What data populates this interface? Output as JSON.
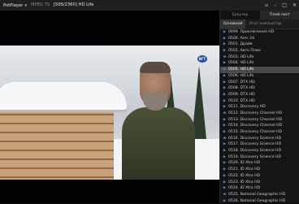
{
  "titlebar": {
    "app_name": "PotPlayer",
    "codec": "MPEG TS",
    "title": "[505/2360] HD Life"
  },
  "video": {
    "channel_logo_text": "ВГТ"
  },
  "panel": {
    "tabs": [
      {
        "label": "Браузер",
        "active": false
      },
      {
        "label": "Плей-лист",
        "active": true
      }
    ],
    "subtabs": [
      {
        "label": "Основной",
        "active": true
      },
      {
        "label": "Этот компьютер",
        "active": false
      }
    ],
    "items": [
      {
        "label": "0499. Приключения HD",
        "icon": "play-icon"
      },
      {
        "label": "0500. Amc 24",
        "icon": "play-icon"
      },
      {
        "label": "0501. Драйв",
        "icon": "play-icon"
      },
      {
        "label": "0502. Авто Плюс",
        "icon": "play-icon"
      },
      {
        "label": "0503. HD Life",
        "icon": "ie-icon"
      },
      {
        "label": "0504. HD Life",
        "icon": "play-icon"
      },
      {
        "label": "0505. HD Life",
        "icon": "play-icon",
        "selected": true
      },
      {
        "label": "0506. HD Life",
        "icon": "play-icon"
      },
      {
        "label": "0507. DTX HD",
        "icon": "play-icon"
      },
      {
        "label": "0508. DTX HD",
        "icon": "play-icon"
      },
      {
        "label": "0509. DTX HD",
        "icon": "play-icon"
      },
      {
        "label": "0510. DTX HD",
        "icon": "play-icon"
      },
      {
        "label": "0511. Discovery HD",
        "icon": "play-icon"
      },
      {
        "label": "0512. Discovery Channel HD",
        "icon": "ie-icon"
      },
      {
        "label": "0513. Discovery Channel HD",
        "icon": "play-icon"
      },
      {
        "label": "0514. Discovery Channel HD",
        "icon": "play-icon"
      },
      {
        "label": "0515. Discovery Channel HD",
        "icon": "play-icon"
      },
      {
        "label": "0516. Discovery Science HD",
        "icon": "ie-icon"
      },
      {
        "label": "0517. Discovery Science HD",
        "icon": "play-icon"
      },
      {
        "label": "0518. Discovery Science HD",
        "icon": "play-icon"
      },
      {
        "label": "0519. Discovery Science HD",
        "icon": "play-icon"
      },
      {
        "label": "0520. ID Xtra HD",
        "icon": "play-icon"
      },
      {
        "label": "0521. ID Xtra HD",
        "icon": "play-icon"
      },
      {
        "label": "0522. ID Xtra HD",
        "icon": "play-icon"
      },
      {
        "label": "0523. ID Xtra HD",
        "icon": "play-icon"
      },
      {
        "label": "0524. ID Xtra HD",
        "icon": "play-icon"
      },
      {
        "label": "0525. National Geographic HD",
        "icon": "ie-icon"
      },
      {
        "label": "0526. National Geographic HD",
        "icon": "play-icon"
      }
    ]
  }
}
